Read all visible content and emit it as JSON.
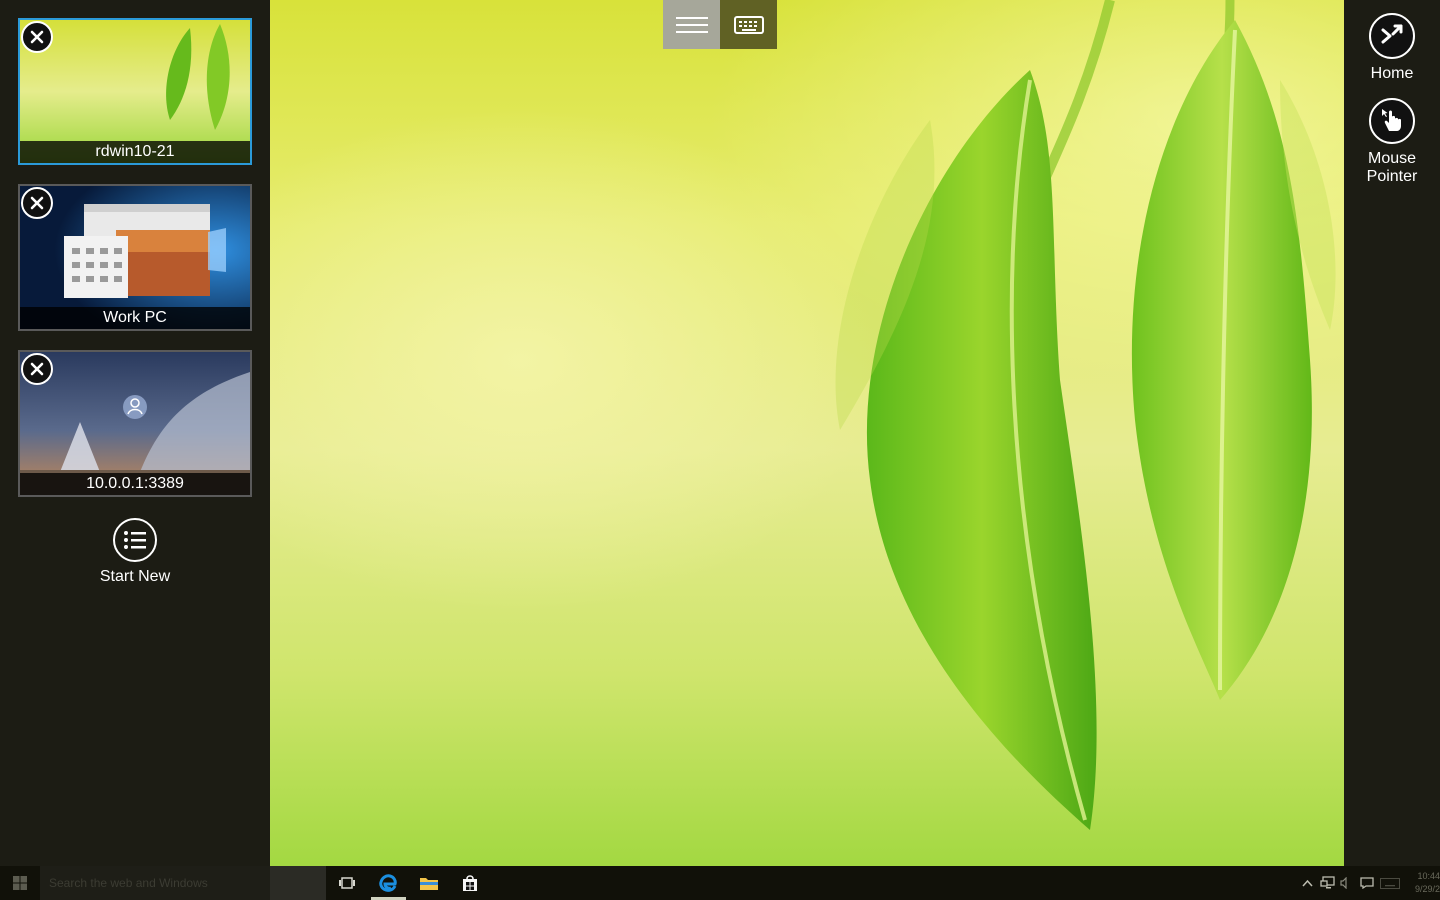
{
  "colors": {
    "accent": "#2b9ad8",
    "panel": "#1c1c14",
    "toolbar_menu": "#a6a79a",
    "toolbar_keyboard": "#606124",
    "taskbar": "#111109"
  },
  "sessions": [
    {
      "label": "rdwin10-21",
      "active": true,
      "thumbnail": "leaf-wallpaper"
    },
    {
      "label": "Work PC",
      "active": false,
      "thumbnail": "windows-desktop"
    },
    {
      "label": "10.0.0.1:3389",
      "active": false,
      "thumbnail": "lock-screen"
    }
  ],
  "start_new": {
    "label": "Start New",
    "icon": "list-icon"
  },
  "actions": [
    {
      "label": "Home",
      "icon": "remote-desktop-icon"
    },
    {
      "label_line1": "Mouse",
      "label_line2": "Pointer",
      "icon": "hand-pointer-icon"
    }
  ],
  "toolbar": {
    "menu_icon": "hamburger-icon",
    "keyboard_icon": "keyboard-icon"
  },
  "taskbar": {
    "search_placeholder": "Search the web and Windows",
    "pinned": [
      "task-view-icon",
      "edge-icon",
      "file-explorer-icon",
      "store-icon"
    ],
    "clock_time": "10:44",
    "clock_date": "9/29/2"
  }
}
